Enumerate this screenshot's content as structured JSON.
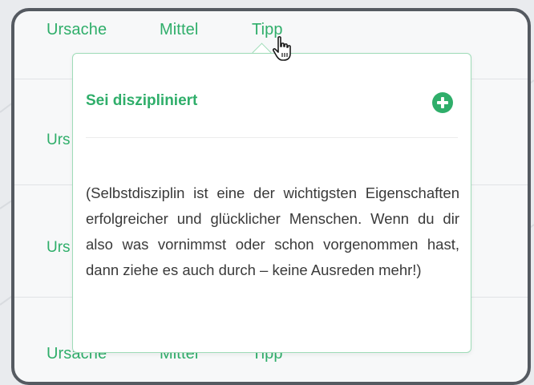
{
  "tabs": {
    "cause": "Ursache",
    "means": "Mittel",
    "tip": "Tipp"
  },
  "rows": [
    {
      "label_fragment": "Urs"
    },
    {
      "label_fragment": "Urs"
    }
  ],
  "bottom_tabs": {
    "cause": "Ursache",
    "means": "Mittel",
    "tip": "Tipp"
  },
  "popover": {
    "title": "Sei diszipliniert",
    "add_icon": "plus-circle-icon",
    "body": "(Selbstdisziplin ist eine der wichtigsten Eigenschaften erfolgreicher und glücklicher Menschen. Wenn du dir also was vornimmst oder schon vorgenommen hast, dann ziehe es auch durch – keine Ausreden mehr!)"
  },
  "colors": {
    "accent": "#2fae6a",
    "frame_border": "#555a61"
  },
  "cursor_icon": "hand-pointer-icon"
}
